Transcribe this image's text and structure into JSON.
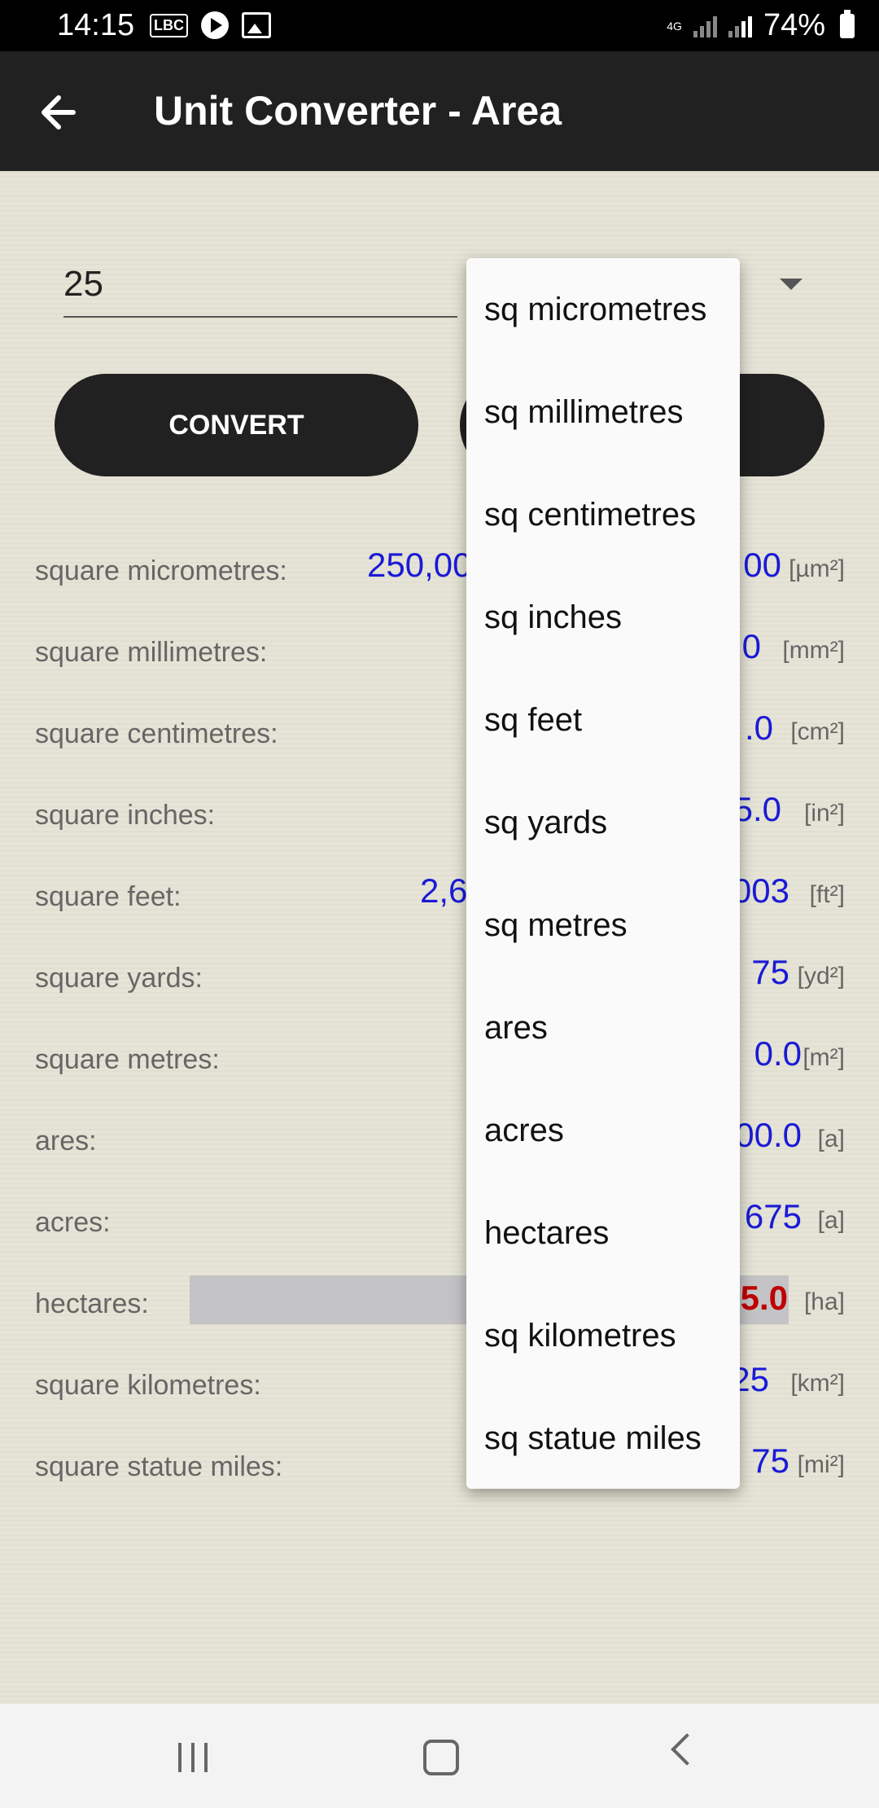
{
  "status_bar": {
    "time": "14:15",
    "network": "4G",
    "battery": "74%"
  },
  "app_bar": {
    "title": "Unit Converter - Area",
    "back_icon": "arrow-left-icon"
  },
  "input": {
    "value": "25"
  },
  "buttons": {
    "convert_label": "CONVERT",
    "second_label": ""
  },
  "results": [
    {
      "label": "square micrometres:",
      "value": "250,00",
      "value_tail": "00",
      "unit": "[µm²]"
    },
    {
      "label": "square millimetres:",
      "value": "",
      "value_tail": "0",
      "unit": "[mm²]"
    },
    {
      "label": "square centimetres:",
      "value": "",
      "value_tail": ".0",
      "unit": "[cm²]"
    },
    {
      "label": "square inches:",
      "value": "",
      "value_tail": "5.0",
      "unit": "[in²]"
    },
    {
      "label": "square feet:",
      "value": "2,6",
      "value_tail": "003",
      "unit": "[ft²]"
    },
    {
      "label": "square yards:",
      "value": "",
      "value_tail": "75",
      "unit": "[yd²]"
    },
    {
      "label": "square metres:",
      "value": "",
      "value_tail": "0.0",
      "unit": "[m²]"
    },
    {
      "label": "ares:",
      "value": "",
      "value_tail": "00.0",
      "unit": "[a]"
    },
    {
      "label": "acres:",
      "value": "",
      "value_tail": "675",
      "unit": "[a]"
    },
    {
      "label": "hectares:",
      "value": "",
      "value_tail": "5.0",
      "unit": "[ha]"
    },
    {
      "label": "square kilometres:",
      "value": "",
      "value_tail": "25",
      "unit": "[km²]"
    },
    {
      "label": "square statue miles:",
      "value": "",
      "value_tail": "75",
      "unit": "[mi²]"
    }
  ],
  "dropdown_menu": [
    "sq micrometres",
    "sq millimetres",
    "sq centimetres",
    "sq inches",
    "sq feet",
    "sq yards",
    "sq metres",
    "ares",
    "acres",
    "hectares",
    "sq kilometres",
    "sq statue miles"
  ]
}
